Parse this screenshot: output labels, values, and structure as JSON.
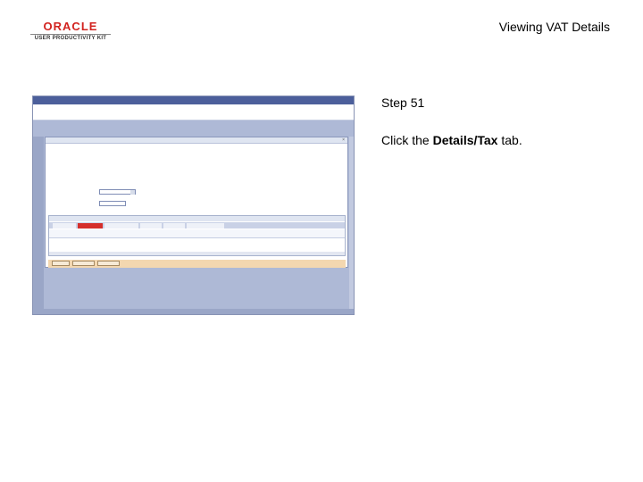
{
  "header": {
    "logo_text": "ORACLE",
    "logo_subtext": "USER PRODUCTIVITY KIT",
    "page_title": "Viewing VAT Details"
  },
  "step": {
    "label": "Step 51",
    "instruction_prefix": "Click the ",
    "instruction_target": "Details/Tax",
    "instruction_suffix": " tab."
  },
  "colors": {
    "brand_red": "#d2231f",
    "menubar_blue": "#4c5f9b",
    "active_tab_red": "#d52f2b"
  },
  "icons": {
    "close": "close-icon"
  }
}
